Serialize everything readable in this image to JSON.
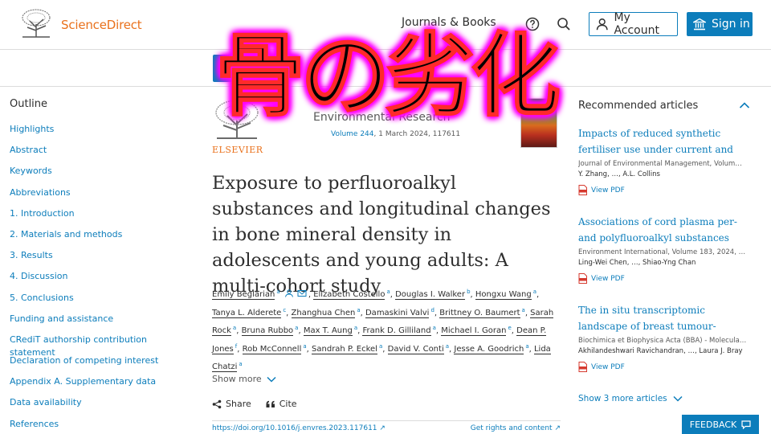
{
  "header": {
    "brand": "ScienceDirect",
    "journals_books": "Journals & Books",
    "my_account": "My Account",
    "sign_in": "Sign in"
  },
  "outline": {
    "title": "Outline",
    "items": [
      "Highlights",
      "Abstract",
      "Keywords",
      "Abbreviations",
      "1. Introduction",
      "2. Materials and methods",
      "3. Results",
      "4. Discussion",
      "5. Conclusions",
      "Funding and assistance",
      "CRediT authorship contribution statement",
      "Declaration of competing interest",
      "Appendix A. Supplementary data",
      "Data availability",
      "References"
    ]
  },
  "article": {
    "publisher": "ELSEVIER",
    "journal": "Environmental Research",
    "volume_link": "Volume 244",
    "volume_rest": ", 1 March 2024, 117611",
    "title": "Exposure to perfluoroalkyl substances and longitudinal changes in bone mineral density in adolescents and young adults: A multi-cohort study",
    "authors": [
      {
        "name": "Emily Beglarian",
        "sup": "a"
      },
      {
        "name": "Elizabeth Costello",
        "sup": "a"
      },
      {
        "name": "Douglas I. Walker",
        "sup": "b"
      },
      {
        "name": "Hongxu Wang",
        "sup": "a"
      },
      {
        "name": "Tanya L. Alderete",
        "sup": "c"
      },
      {
        "name": "Zhanghua Chen",
        "sup": "a"
      },
      {
        "name": "Damaskini Valvi",
        "sup": "d"
      },
      {
        "name": "Brittney O. Baumert",
        "sup": "a"
      },
      {
        "name": "Sarah Rock",
        "sup": "a"
      },
      {
        "name": "Bruna Rubbo",
        "sup": "a"
      },
      {
        "name": "Max T. Aung",
        "sup": "a"
      },
      {
        "name": "Frank D. Gilliland",
        "sup": "a"
      },
      {
        "name": "Michael I. Goran",
        "sup": "e"
      },
      {
        "name": "Dean P. Jones",
        "sup": "f"
      },
      {
        "name": "Rob McConnell",
        "sup": "a"
      },
      {
        "name": "Sandrah P. Eckel",
        "sup": "a"
      },
      {
        "name": "David V. Conti",
        "sup": "a"
      },
      {
        "name": "Jesse A. Goodrich",
        "sup": "a"
      },
      {
        "name": "Lida Chatzi",
        "sup": "a"
      }
    ],
    "show_more": "Show more",
    "share": "Share",
    "cite": "Cite",
    "doi": "https://doi.org/10.1016/j.envres.2023.117611",
    "rights": "Get rights and content"
  },
  "recommended": {
    "title": "Recommended articles",
    "items": [
      {
        "title": "Impacts of reduced synthetic fertiliser use under current and future climat…",
        "journal": "Journal of Environmental Management, Volum…",
        "authors": "Y. Zhang, …, A.L. Collins",
        "pdf": "View PDF"
      },
      {
        "title": "Associations of cord plasma per- and polyfluoroalkyl substances (PFAS) wi…",
        "journal": "Environment International, Volume 183, 2024, …",
        "authors": "Ling-Wei Chen, …, Shiao-Yng Chan",
        "pdf": "View PDF"
      },
      {
        "title": "The in situ transcriptomic landscape of breast tumour-associated and…",
        "journal": "Biochimica et Biophysica Acta (BBA) - Molecula…",
        "authors": "Akhilandeshwari Ravichandran, …, Laura J. Bray",
        "pdf": "View PDF"
      }
    ],
    "show_more": "Show 3 more articles"
  },
  "feedback": "FEEDBACK",
  "overlay": "骨の劣化",
  "colors": {
    "brand_orange": "#e9711c",
    "link_blue": "#0c7dbb",
    "overlay_glow": "#ff00ff",
    "overlay_stroke": "#ff2a2a"
  }
}
